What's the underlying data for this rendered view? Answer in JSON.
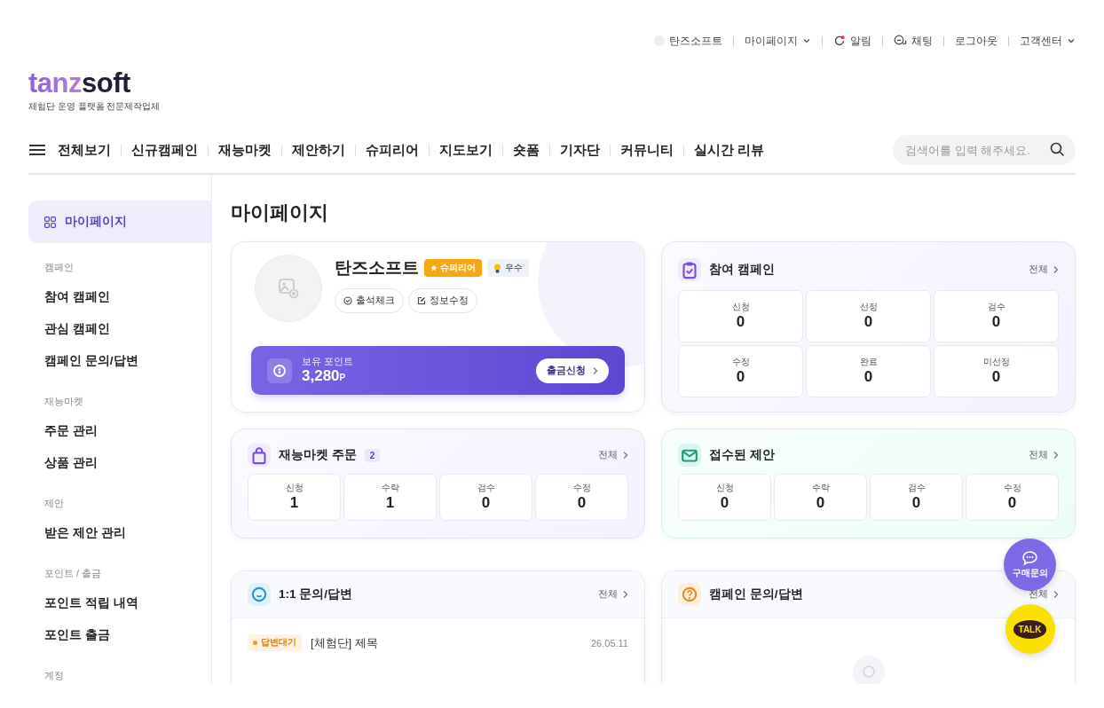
{
  "util_links": [
    {
      "label": "탄즈소프트",
      "kind": "avatar"
    },
    {
      "label": "마이페이지",
      "kind": "dropdown"
    },
    {
      "label": "알림",
      "kind": "alert"
    },
    {
      "label": "채팅",
      "kind": "chat"
    },
    {
      "label": "로그아웃",
      "kind": "plain"
    },
    {
      "label": "고객센터",
      "kind": "dropdown"
    }
  ],
  "logo": {
    "accent": "tanz",
    "rest": "soft",
    "tagline": "체험단 운영 플랫폼 전문제작업체"
  },
  "nav": {
    "items": [
      "전체보기",
      "신규캠페인",
      "재능마켓",
      "제안하기",
      "슈피리어",
      "지도보기",
      "숏폼",
      "기자단",
      "커뮤니티",
      "실시간 리뷰"
    ],
    "search": {
      "placeholder": "검색어를 입력 해주세요."
    }
  },
  "sidebar": {
    "items": [
      {
        "kind": "home",
        "label": "마이페이지",
        "selected": true
      },
      {
        "kind": "heading",
        "label": "캠페인"
      },
      {
        "kind": "link",
        "label": "참여 캠페인",
        "selected": false
      },
      {
        "kind": "link",
        "label": "관심 캠페인",
        "selected": false
      },
      {
        "kind": "link",
        "label": "캠페인 문의/답변",
        "selected": false
      },
      {
        "kind": "heading",
        "label": "재능마켓"
      },
      {
        "kind": "link",
        "label": "주문 관리",
        "selected": false
      },
      {
        "kind": "link",
        "label": "상품 관리",
        "selected": false
      },
      {
        "kind": "heading",
        "label": "제안"
      },
      {
        "kind": "link",
        "label": "받은 제안 관리",
        "selected": false
      },
      {
        "kind": "heading",
        "label": "포인트 / 출금"
      },
      {
        "kind": "link",
        "label": "포인트 적립 내역",
        "selected": false
      },
      {
        "kind": "link",
        "label": "포인트 출금",
        "selected": false
      },
      {
        "kind": "heading",
        "label": "계정"
      }
    ]
  },
  "page_title": "마이페이지",
  "cards": [
    {
      "kind": "profile",
      "name": "탄즈소프트",
      "badges": [
        {
          "kind": "grade",
          "label": "슈피리어"
        },
        {
          "kind": "level",
          "label": "우수"
        }
      ],
      "actions": [
        {
          "kind": "check",
          "label": "출석체크"
        },
        {
          "kind": "edit",
          "label": "정보수정"
        }
      ],
      "points": {
        "label": "보유 포인트",
        "value": "3,280",
        "unit": "P",
        "button": "출금신청"
      }
    },
    {
      "kind": "campaigns",
      "title": "참여 캠페인",
      "link": "전체",
      "stats": [
        {
          "label": "신청",
          "value": "0"
        },
        {
          "label": "선정",
          "value": "0"
        },
        {
          "label": "검수",
          "value": "0"
        },
        {
          "label": "수정",
          "value": "0"
        },
        {
          "label": "완료",
          "value": "0"
        },
        {
          "label": "미선정",
          "value": "0"
        }
      ]
    },
    {
      "kind": "orders",
      "title": "재능마켓 주문",
      "count": "2",
      "link": "전체",
      "stats": [
        {
          "label": "신청",
          "value": "1"
        },
        {
          "label": "수락",
          "value": "1"
        },
        {
          "label": "검수",
          "value": "0"
        },
        {
          "label": "수정",
          "value": "0"
        }
      ]
    },
    {
      "kind": "proposals",
      "title": "접수된 제안",
      "link": "전체",
      "stats": [
        {
          "label": "신청",
          "value": "0"
        },
        {
          "label": "수락",
          "value": "0"
        },
        {
          "label": "검수",
          "value": "0"
        },
        {
          "label": "수정",
          "value": "0"
        }
      ]
    },
    {
      "kind": "inquiries",
      "title": "1:1 문의/답변",
      "link": "전체",
      "rows": [
        {
          "status": "답변대기",
          "title": "[체험단] 제목",
          "date": "26.05.11"
        }
      ]
    },
    {
      "kind": "questions",
      "title": "캠페인 문의/답변",
      "link": "전체"
    }
  ],
  "floating": [
    {
      "kind": "inquiry",
      "label": "구매문의"
    },
    {
      "kind": "talk",
      "label": "TALK"
    }
  ]
}
